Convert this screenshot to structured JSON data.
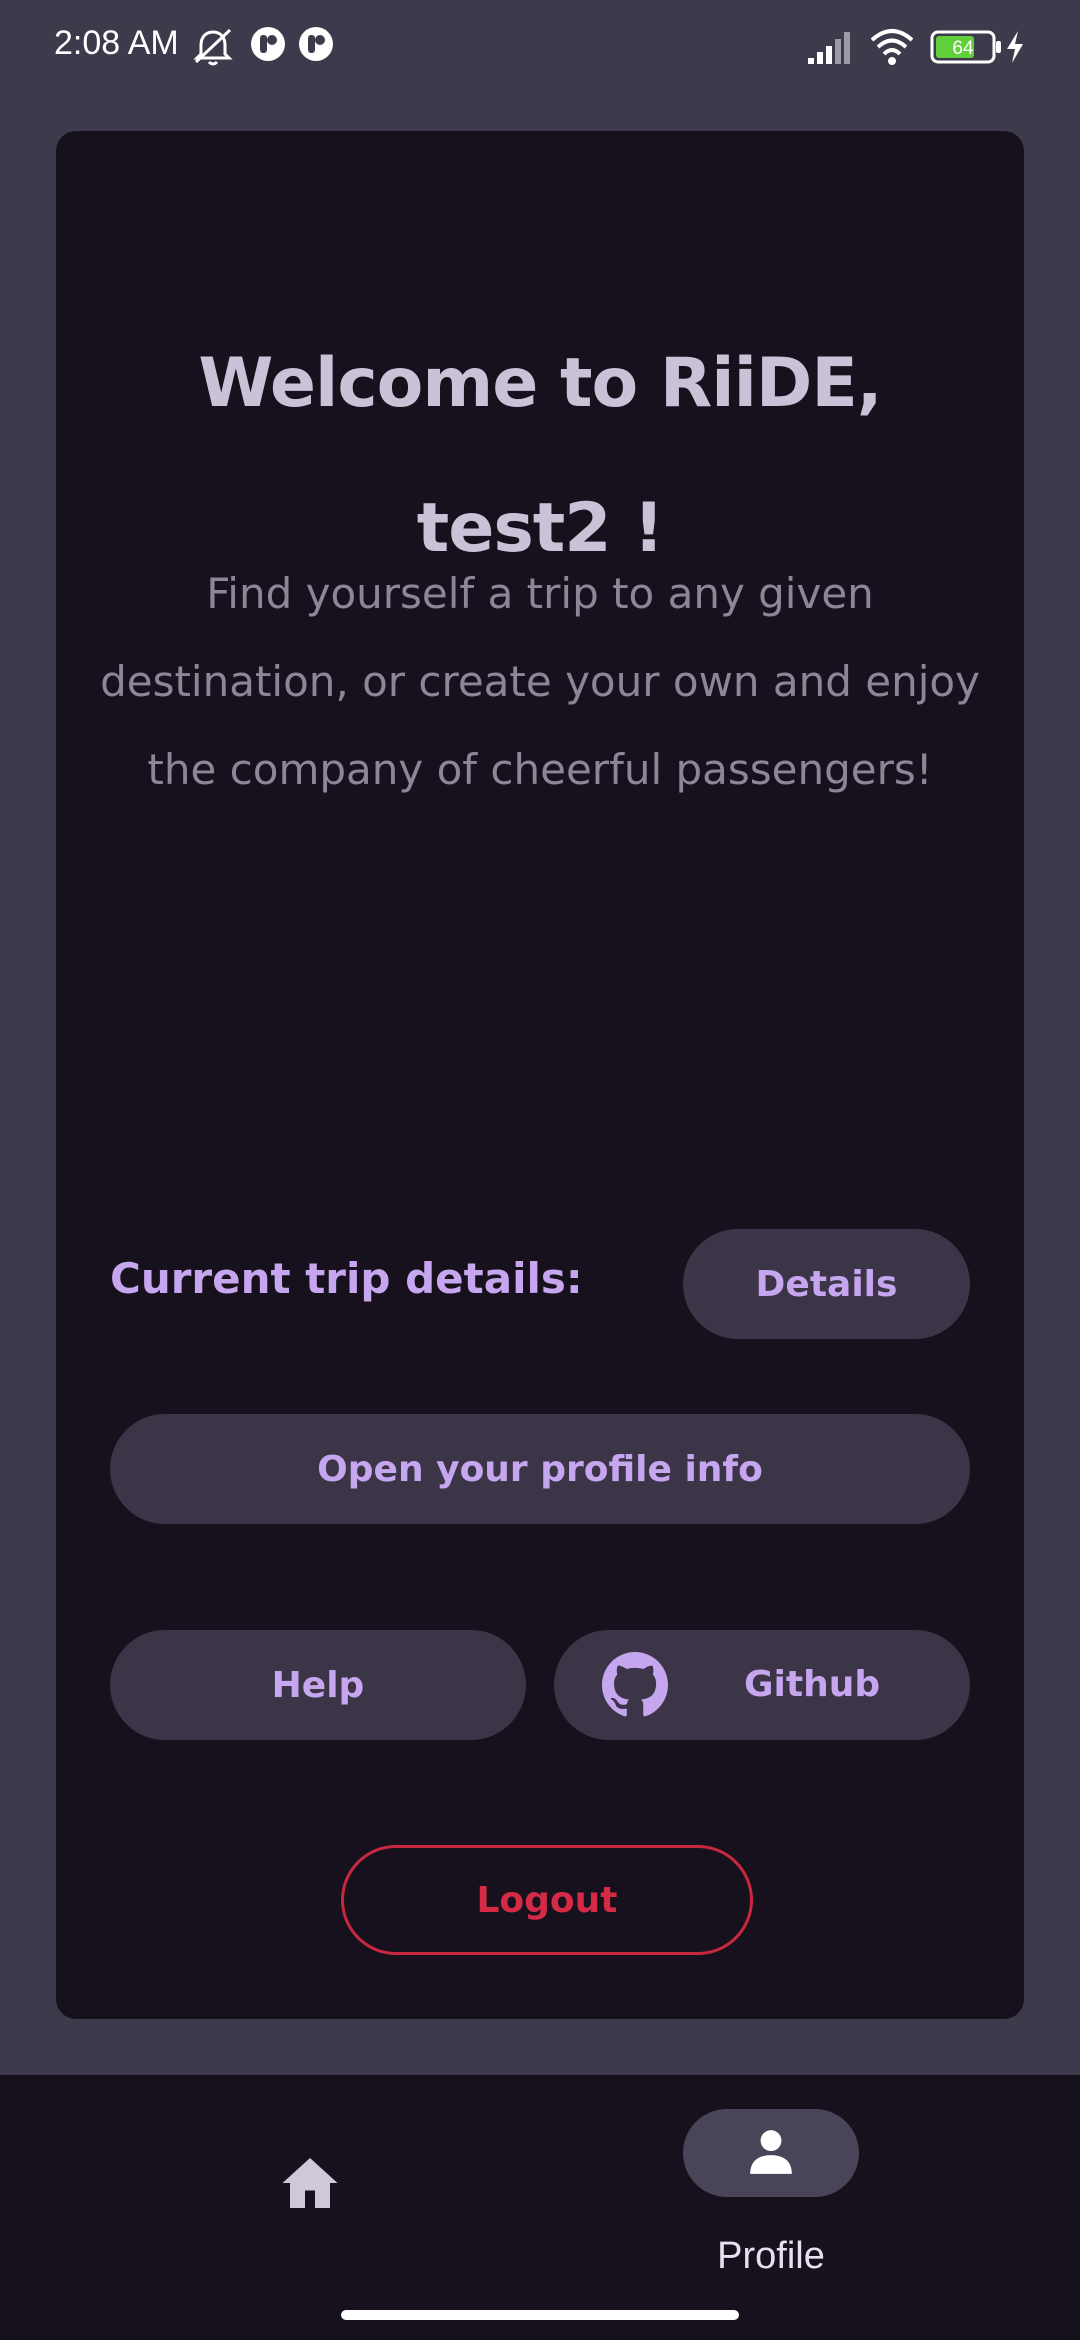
{
  "status_bar": {
    "time": "2:08 AM",
    "battery_level": "64",
    "icons": [
      "mute-icon",
      "app-notification-icon",
      "app-notification-icon",
      "signal-icon",
      "wifi-icon",
      "battery-icon",
      "charging-icon"
    ]
  },
  "card": {
    "welcome_line1": "Welcome to RiiDE,",
    "welcome_line2": "test2 !",
    "tagline_line1": "Find yourself a trip to any given",
    "tagline_line2": "destination, or create your own and enjoy",
    "tagline_line3": "the company of cheerful passengers!",
    "current_trip_label": "Current trip details:",
    "details_button": "Details",
    "profile_button": "Open your profile info",
    "help_button": "Help",
    "github_button": "Github",
    "logout_button": "Logout"
  },
  "bottom_nav": {
    "items": [
      {
        "icon": "home-icon",
        "label": "",
        "active": false
      },
      {
        "icon": "person-icon",
        "label": "Profile",
        "active": true
      }
    ]
  },
  "colors": {
    "background": "#3d3a4b",
    "card": "#16111c",
    "accent": "#c7a6f0",
    "button": "#3b3547",
    "danger": "#d42a46",
    "title": "#cbc2d8"
  }
}
